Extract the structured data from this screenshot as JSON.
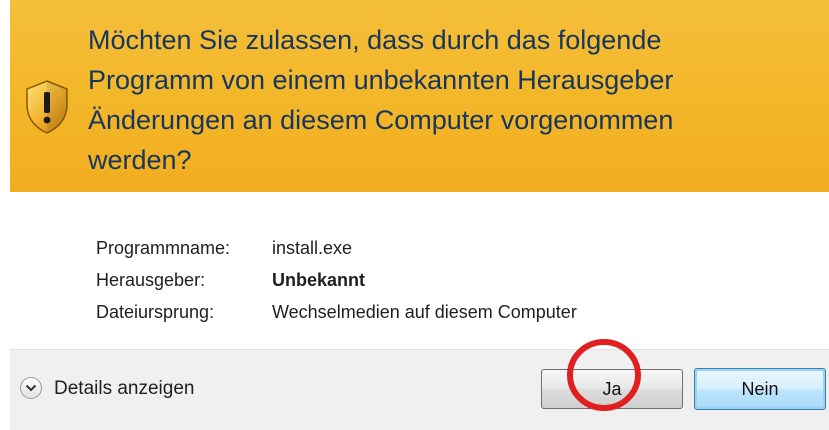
{
  "dialog": {
    "question": "Möchten Sie zulassen, dass durch das folgende\nProgramm von einem unbekannten Herausgeber\nÄnderungen an diesem Computer vorgenommen\nwerden?",
    "fields": [
      {
        "label": "Programmname:",
        "value": "install.exe",
        "bold": false
      },
      {
        "label": "Herausgeber:",
        "value": "Unbekannt",
        "bold": true
      },
      {
        "label": "Dateiursprung:",
        "value": "Wechselmedien auf diesem Computer",
        "bold": false
      }
    ],
    "details_label": "Details anzeigen",
    "yes_label": "Ja",
    "no_label": "Nein"
  },
  "colors": {
    "header": "#f3b628",
    "question_text": "#17365d",
    "highlight_ring": "#e02020",
    "no_button_border": "#3c7fb1"
  },
  "icons": {
    "header_icon": "uac-warning-shield-icon",
    "details_icon": "chevron-down-circle-icon"
  }
}
